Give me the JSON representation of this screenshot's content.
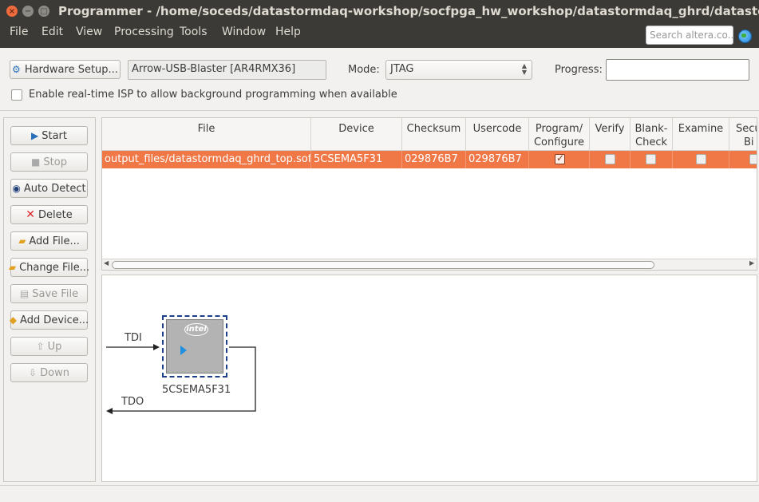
{
  "window": {
    "title": "Programmer - /home/soceds/datastormdaq-workshop/socfpga_hw_workshop/datastormdaq_ghrd/datastormdaq_ghrd - d"
  },
  "menu": {
    "items": [
      "File",
      "Edit",
      "View",
      "Processing",
      "Tools",
      "Window",
      "Help"
    ],
    "search_placeholder": "Search altera.co..."
  },
  "toolbar": {
    "hardware_setup_label": "Hardware Setup...",
    "hardware_value": "Arrow-USB-Blaster [AR4RMX36]",
    "mode_label": "Mode:",
    "mode_value": "JTAG",
    "progress_label": "Progress:",
    "isp_label": "Enable real-time ISP to allow background programming when available"
  },
  "side_buttons": {
    "start": "Start",
    "stop": "Stop",
    "auto_detect": "Auto Detect",
    "delete": "Delete",
    "add_file": "Add File...",
    "change_file": "Change File...",
    "save_file": "Save File",
    "add_device": "Add Device...",
    "up": "Up",
    "down": "Down"
  },
  "table": {
    "headers": {
      "file": "File",
      "device": "Device",
      "checksum": "Checksum",
      "usercode": "Usercode",
      "program_line1": "Program/",
      "program_line2": "Configure",
      "verify": "Verify",
      "blank_line1": "Blank-",
      "blank_line2": "Check",
      "examine": "Examine",
      "security_line1": "Secu",
      "security_line2": "Bi"
    },
    "rows": [
      {
        "file": "output_files/datastormdaq_ghrd_top.sof",
        "device": "5CSEMA5F31",
        "checksum": "029876B7",
        "usercode": "029876B7",
        "program": true,
        "verify": false,
        "blank_check": false,
        "examine": false
      }
    ]
  },
  "chain": {
    "tdi": "TDI",
    "tdo": "TDO",
    "device_name": "5CSEMA5F31",
    "logo_text": "intel"
  }
}
